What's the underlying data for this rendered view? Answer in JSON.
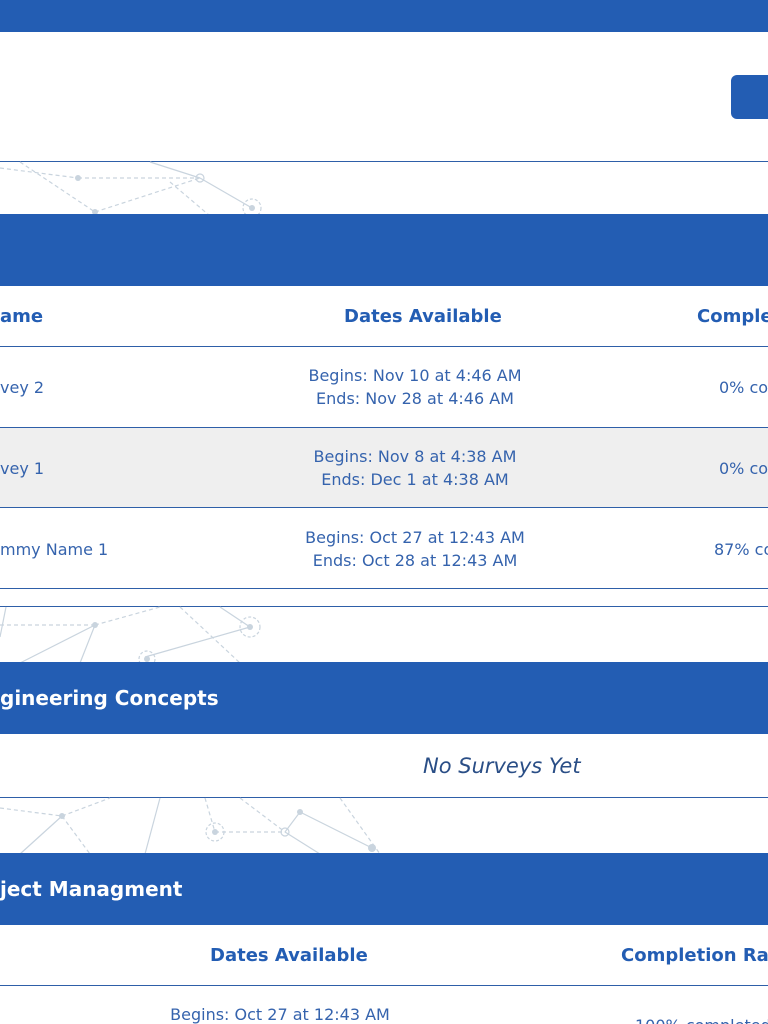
{
  "colors": {
    "primary": "#235db3",
    "text": "#3563ad",
    "row_alt": "#efefef",
    "deco": "#c9d4de"
  },
  "sections": [
    {
      "title": "",
      "columns": [
        "ame",
        "Dates Available",
        "Comple"
      ],
      "rows": [
        {
          "name": "vey 2",
          "begins": "Begins: Nov 10 at 4:46 AM",
          "ends": "Ends: Nov 28 at 4:46 AM",
          "completion": "0% co"
        },
        {
          "name": "vey 1",
          "begins": "Begins: Nov 8 at 4:38 AM",
          "ends": "Ends: Dec 1 at 4:38 AM",
          "completion": "0% co"
        },
        {
          "name": "mmy Name 1",
          "begins": "Begins: Oct 27 at 12:43 AM",
          "ends": "Ends: Oct 28 at 12:43 AM",
          "completion": "87% co"
        }
      ]
    },
    {
      "title": "gineering Concepts",
      "empty_message": "No Surveys Yet"
    },
    {
      "title": "ject Managment",
      "columns": [
        "Dates Available",
        "Completion Rat"
      ],
      "rows": [
        {
          "begins": "Begins: Oct 27 at 12:43 AM",
          "completion": "100% completed"
        }
      ]
    }
  ]
}
